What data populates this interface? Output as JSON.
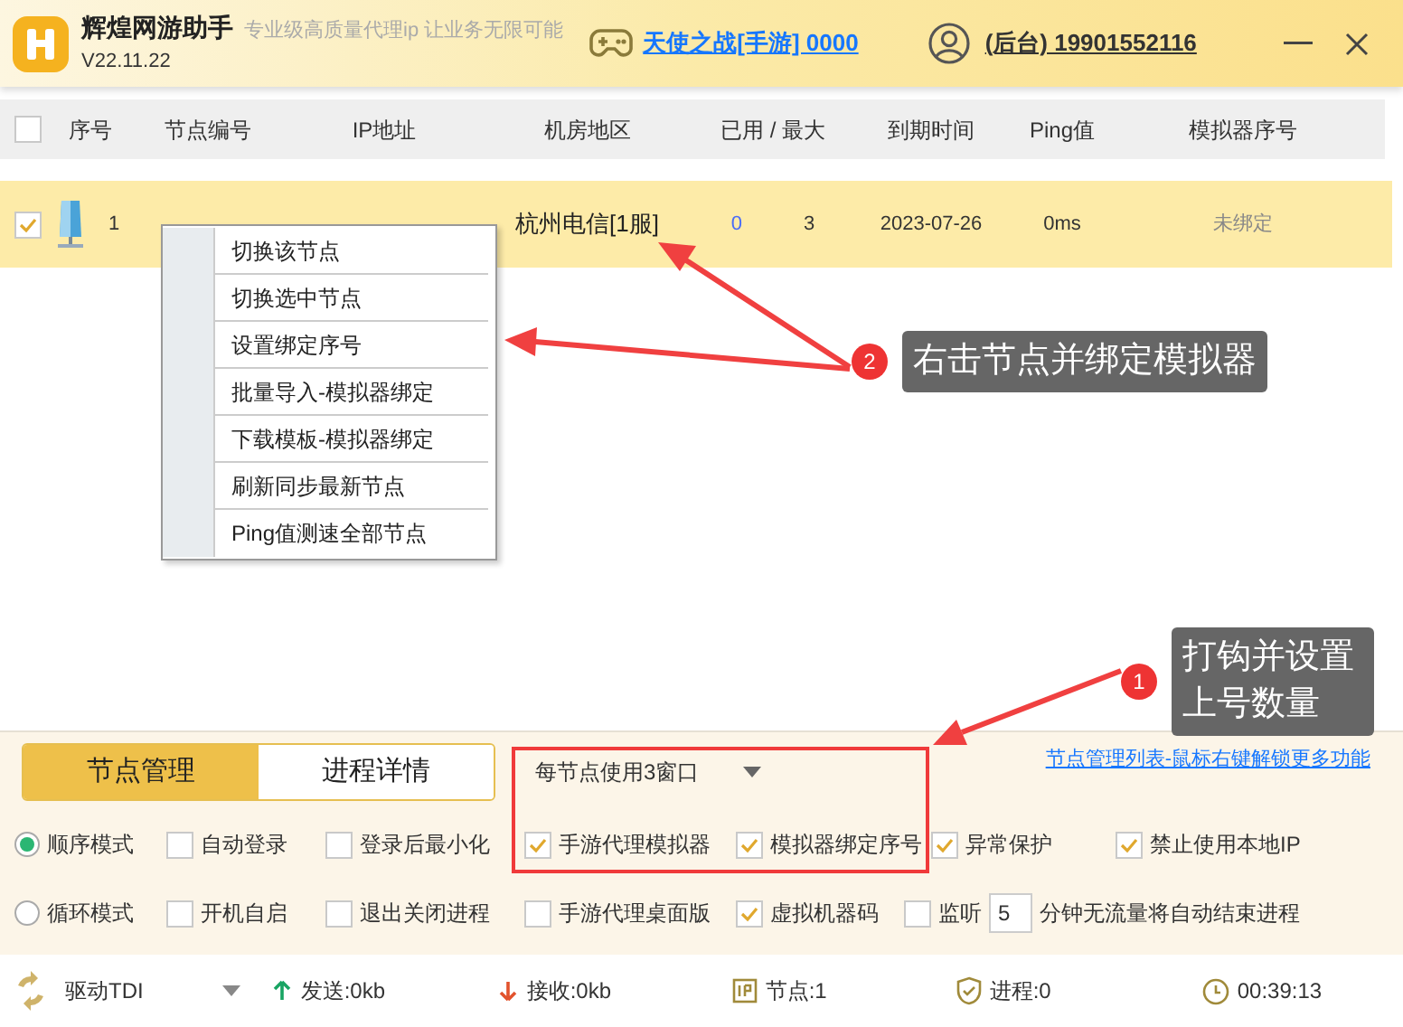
{
  "app": {
    "name": "辉煌网游助手",
    "version": "V22.11.22",
    "slogan": "专业级高质量代理ip 让业务无限可能",
    "game_link": "天使之战[手游] 0000",
    "account_link": "(后台) 19901552116"
  },
  "table": {
    "all_checked": false,
    "columns": [
      "序号",
      "节点编号",
      "IP地址",
      "机房地区",
      "已用 / 最大",
      "到期时间",
      "Ping值",
      "模拟器序号"
    ],
    "rows": [
      {
        "checked": true,
        "index": "1",
        "region": "杭州电信[1服]",
        "used": "0",
        "max": "3",
        "expires": "2023-07-26",
        "ping": "0ms",
        "emulator": "未绑定"
      }
    ]
  },
  "context_menu": [
    "切换该节点",
    "切换选中节点",
    "设置绑定序号",
    "批量导入-模拟器绑定",
    "下载模板-模拟器绑定",
    "刷新同步最新节点",
    "Ping值测速全部节点"
  ],
  "annotations": [
    {
      "number": "2",
      "text": "右击节点并绑定模拟器"
    },
    {
      "number": "1",
      "text": "打钩并设置上号数量"
    }
  ],
  "tabs": [
    {
      "label": "节点管理",
      "selected": true
    },
    {
      "label": "进程详情",
      "selected": false
    }
  ],
  "window_select": "每节点使用3窗口",
  "help_link": "节点管理列表-鼠标右键解锁更多功能",
  "options": [
    [
      {
        "kind": "radio",
        "label": "顺序模式",
        "checked": true
      },
      {
        "kind": "checkbox",
        "label": "自动登录",
        "checked": false
      },
      {
        "kind": "checkbox",
        "label": "登录后最小化",
        "checked": false
      },
      {
        "kind": "checkbox",
        "label": "手游代理模拟器",
        "checked": true
      },
      {
        "kind": "checkbox",
        "label": "模拟器绑定序号",
        "checked": true
      },
      {
        "kind": "checkbox",
        "label": "异常保护",
        "checked": true
      },
      {
        "kind": "checkbox",
        "label": "禁止使用本地IP",
        "checked": true
      }
    ],
    [
      {
        "kind": "radio",
        "label": "循环模式",
        "checked": false
      },
      {
        "kind": "checkbox",
        "label": "开机自启",
        "checked": false
      },
      {
        "kind": "checkbox",
        "label": "退出关闭进程",
        "checked": false
      },
      {
        "kind": "checkbox",
        "label": "手游代理桌面版",
        "checked": false
      },
      {
        "kind": "checkbox",
        "label": "虚拟机器码",
        "checked": true
      },
      {
        "kind": "timeout",
        "label": "监听",
        "checked": false,
        "value": "5",
        "suffix": "分钟无流量将自动结束进程"
      }
    ]
  ],
  "status_bar": {
    "driver": "驱动TDI",
    "sent": "发送:0kb",
    "received": "接收:0kb",
    "nodes": "节点:1",
    "processes": "进程:0",
    "time": "00:39:13"
  }
}
